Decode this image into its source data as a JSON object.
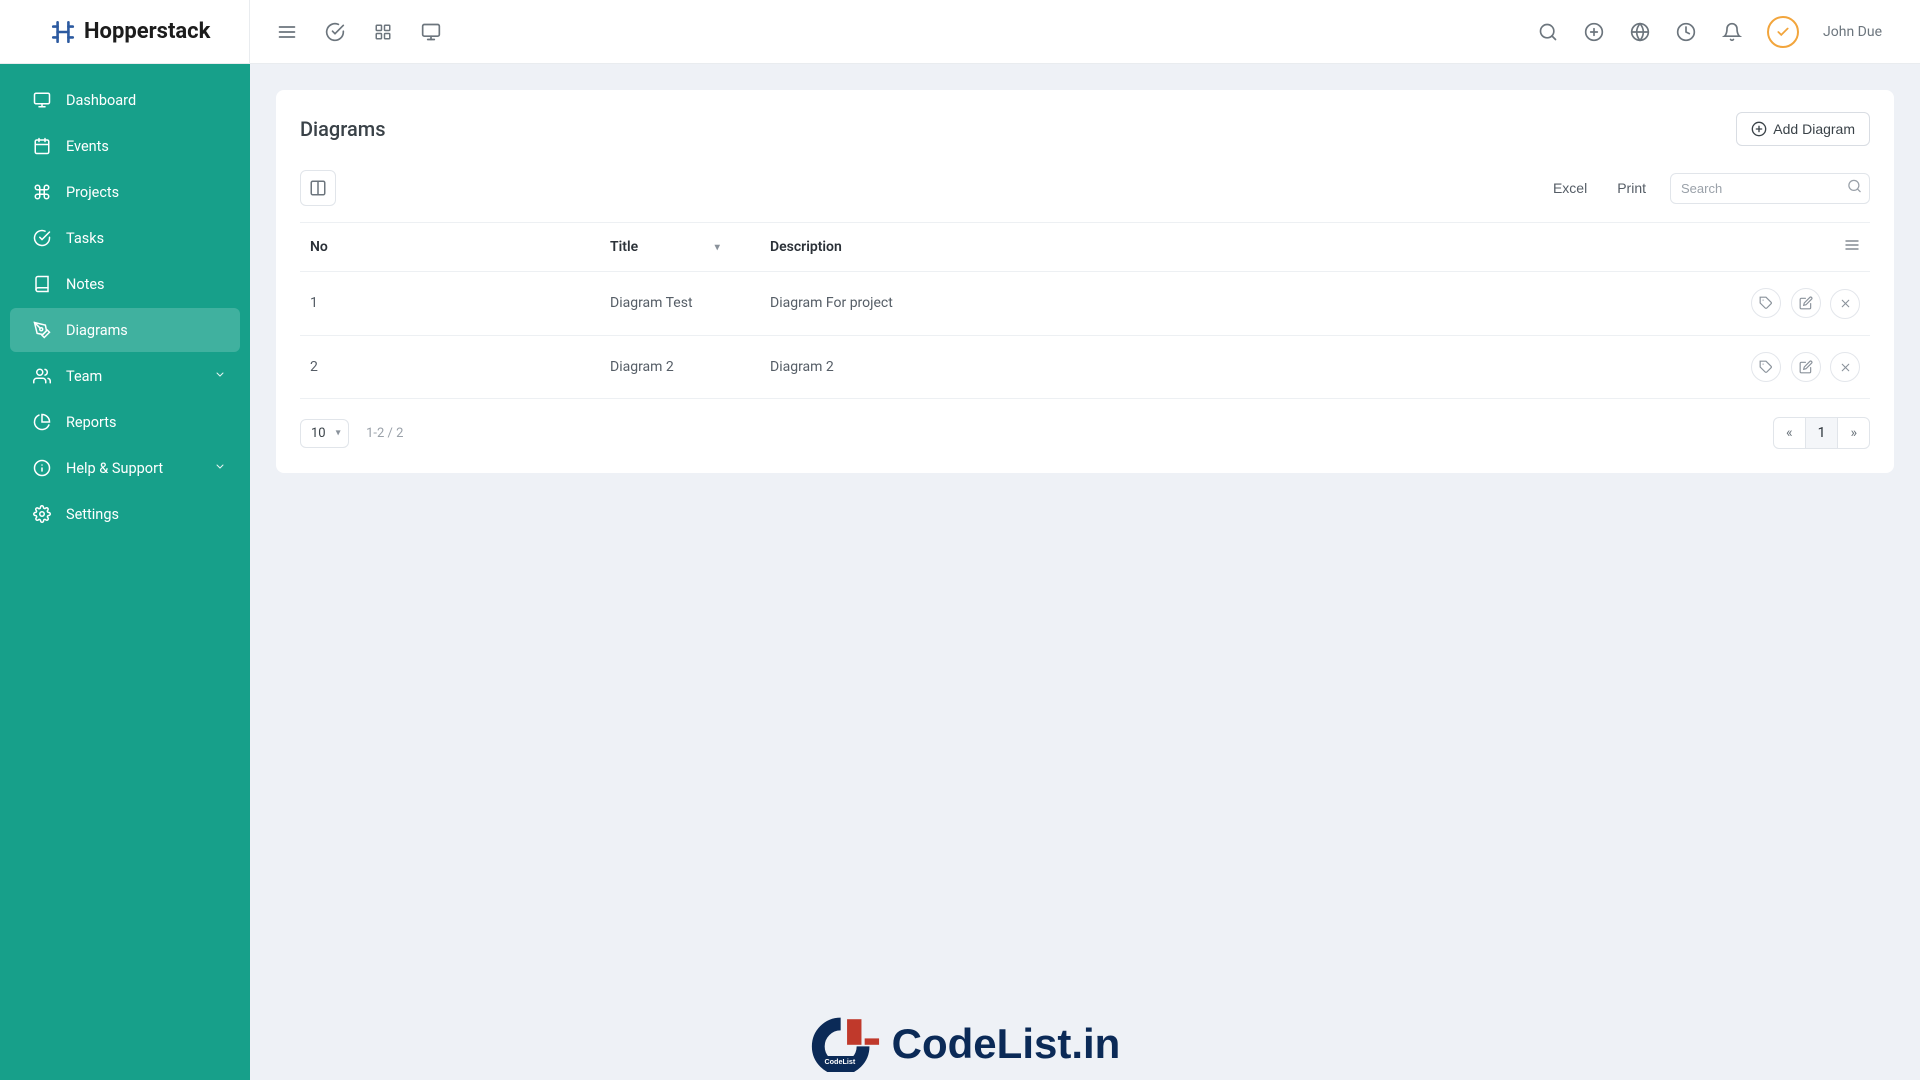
{
  "brand": {
    "name": "Hopperstack"
  },
  "colors": {
    "accent": "#17a08a",
    "avatarRing": "#f2a53c"
  },
  "user": {
    "name": "John Due"
  },
  "sidebar": {
    "items": [
      {
        "label": "Dashboard"
      },
      {
        "label": "Events"
      },
      {
        "label": "Projects"
      },
      {
        "label": "Tasks"
      },
      {
        "label": "Notes"
      },
      {
        "label": "Diagrams"
      },
      {
        "label": "Team"
      },
      {
        "label": "Reports"
      },
      {
        "label": "Help & Support"
      },
      {
        "label": "Settings"
      }
    ]
  },
  "page": {
    "title": "Diagrams",
    "addLabel": "Add Diagram",
    "toolbar": {
      "excel": "Excel",
      "print": "Print",
      "searchPlaceholder": "Search"
    },
    "columns": {
      "no": "No",
      "title": "Title",
      "description": "Description"
    },
    "rows": [
      {
        "no": "1",
        "title": "Diagram Test",
        "description": "Diagram For project"
      },
      {
        "no": "2",
        "title": "Diagram 2",
        "description": "Diagram 2"
      }
    ],
    "pagination": {
      "perPage": "10",
      "rangeText": "1-2 / 2",
      "currentPage": "1"
    }
  },
  "watermark": {
    "text": "CodeList.in"
  }
}
